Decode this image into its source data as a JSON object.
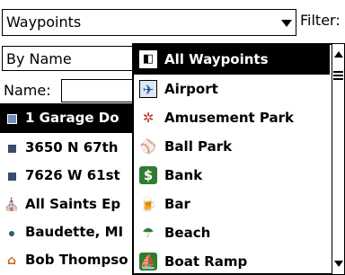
{
  "header": {
    "category_value": "Waypoints",
    "filter_label": "Filter:"
  },
  "sort": {
    "value": "By Name"
  },
  "name_field": {
    "label": "Name:",
    "value": ""
  },
  "waypoints": [
    {
      "label": "1 Garage Do",
      "icon": "blue-square-icon",
      "selected": true
    },
    {
      "label": "3650 N 67th",
      "icon": "blue-square-icon",
      "selected": false
    },
    {
      "label": "7626 W 61st",
      "icon": "blue-square-icon",
      "selected": false
    },
    {
      "label": "All Saints Ep",
      "icon": "church-icon",
      "selected": false
    },
    {
      "label": "Baudette, MI",
      "icon": "dot-icon",
      "selected": false
    },
    {
      "label": "Bob Thompso",
      "icon": "house-icon",
      "selected": false
    }
  ],
  "filter_options": [
    {
      "label": "All Waypoints",
      "icon": "all-waypoints-icon",
      "selected": true
    },
    {
      "label": "Airport",
      "icon": "airport-icon",
      "selected": false
    },
    {
      "label": "Amusement Park",
      "icon": "amusement-park-icon",
      "selected": false
    },
    {
      "label": "Ball Park",
      "icon": "ball-park-icon",
      "selected": false
    },
    {
      "label": "Bank",
      "icon": "bank-icon",
      "selected": false
    },
    {
      "label": "Bar",
      "icon": "bar-icon",
      "selected": false
    },
    {
      "label": "Beach",
      "icon": "beach-icon",
      "selected": false
    },
    {
      "label": "Boat Ramp",
      "icon": "boat-ramp-icon",
      "selected": false
    }
  ]
}
